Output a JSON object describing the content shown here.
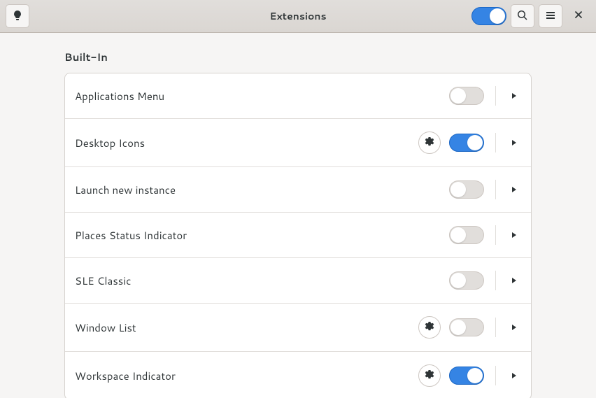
{
  "header": {
    "title": "Extensions"
  },
  "section": {
    "title": "Built-In"
  },
  "extensions": [
    {
      "name": "Applications Menu",
      "enabled": false,
      "has_settings": false
    },
    {
      "name": "Desktop Icons",
      "enabled": true,
      "has_settings": true
    },
    {
      "name": "Launch new instance",
      "enabled": false,
      "has_settings": false
    },
    {
      "name": "Places Status Indicator",
      "enabled": false,
      "has_settings": false
    },
    {
      "name": "SLE Classic",
      "enabled": false,
      "has_settings": false
    },
    {
      "name": "Window List",
      "enabled": false,
      "has_settings": true
    },
    {
      "name": "Workspace Indicator",
      "enabled": true,
      "has_settings": true
    }
  ],
  "master_enabled": true
}
